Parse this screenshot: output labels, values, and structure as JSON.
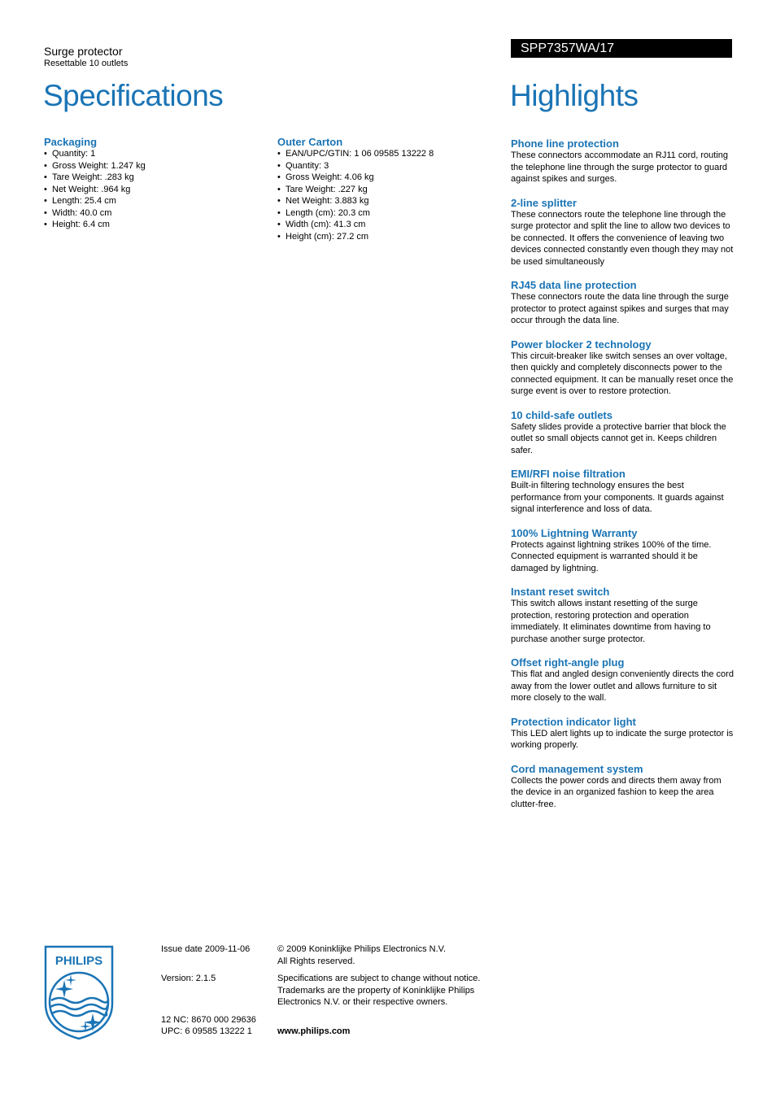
{
  "header": {
    "product_title": "Surge protector",
    "product_subtitle": "Resettable 10 outlets",
    "model_number": "SPP7357WA/17",
    "specifications_heading": "Specifications",
    "highlights_heading": "Highlights"
  },
  "colors": {
    "accent_blue": "#1a74b5",
    "model_bar_bg": "#000000",
    "model_bar_text": "#ffffff"
  },
  "specifications": {
    "packaging": {
      "title": "Packaging",
      "items": [
        "Quantity: 1",
        "Gross Weight: 1.247 kg",
        "Tare Weight: .283 kg",
        "Net Weight: .964 kg",
        "Length: 25.4 cm",
        "Width: 40.0 cm",
        "Height: 6.4 cm"
      ]
    },
    "outer_carton": {
      "title": "Outer Carton",
      "items": [
        "EAN/UPC/GTIN: 1 06 09585 13222 8",
        "Quantity: 3",
        "Gross Weight: 4.06 kg",
        "Tare Weight: .227 kg",
        "Net Weight: 3.883 kg",
        "Length (cm): 20.3 cm",
        "Width (cm): 41.3 cm",
        "Height (cm): 27.2 cm"
      ]
    }
  },
  "highlights": [
    {
      "title": "Phone line protection",
      "text": "These connectors accommodate an RJ11 cord, routing the telephone line through the surge protector to guard against spikes and surges."
    },
    {
      "title": "2-line splitter",
      "text": "These connectors route the telephone line through the surge protector and split the line to allow two devices to be connected. It offers the convenience of leaving two devices connected constantly even though they may not be used simultaneously"
    },
    {
      "title": "RJ45 data line protection",
      "text": "These connectors route the data line through the surge protector to protect against spikes and surges that may occur through the data line."
    },
    {
      "title": "Power blocker 2 technology",
      "text": "This circuit-breaker like switch senses an over voltage, then quickly and completely disconnects power to the connected equipment. It can be manually reset once the surge event is over to restore protection."
    },
    {
      "title": "10 child-safe outlets",
      "text": "Safety slides provide a protective barrier that block the outlet so small objects cannot get in. Keeps children safer."
    },
    {
      "title": "EMI/RFI noise filtration",
      "text": "Built-in filtering technology ensures the best performance from your components. It guards against signal interference and loss of data."
    },
    {
      "title": "100% Lightning Warranty",
      "text": "Protects against lightning strikes 100% of the time. Connected equipment is warranted should it be damaged by lightning."
    },
    {
      "title": "Instant reset switch",
      "text": "This switch allows instant resetting of the surge protection, restoring protection and operation immediately. It eliminates downtime from having to purchase another surge protector."
    },
    {
      "title": "Offset right-angle plug",
      "text": "This flat and angled design conveniently directs the cord away from the lower outlet and allows furniture to sit more closely to the wall."
    },
    {
      "title": "Protection indicator light",
      "text": "This LED alert lights up to indicate the surge protector is working properly."
    },
    {
      "title": "Cord management system",
      "text": "Collects the power cords and directs them away from the device in an organized fashion to keep the area clutter-free."
    }
  ],
  "footer": {
    "logo_text": "PHILIPS",
    "logo_icon": "philips-shield-logo",
    "issue_date": "Issue date 2009-11-06",
    "version": "Version: 2.1.5",
    "nc_12": "12 NC: 8670 000 29636",
    "upc": "UPC: 6 09585 13222 1",
    "copyright": "© 2009 Koninklijke Philips Electronics N.V.",
    "rights": "All Rights reserved.",
    "disclaimer": "Specifications are subject to change without notice. Trademarks are the property of Koninklijke Philips Electronics N.V. or their respective owners.",
    "website": "www.philips.com"
  }
}
